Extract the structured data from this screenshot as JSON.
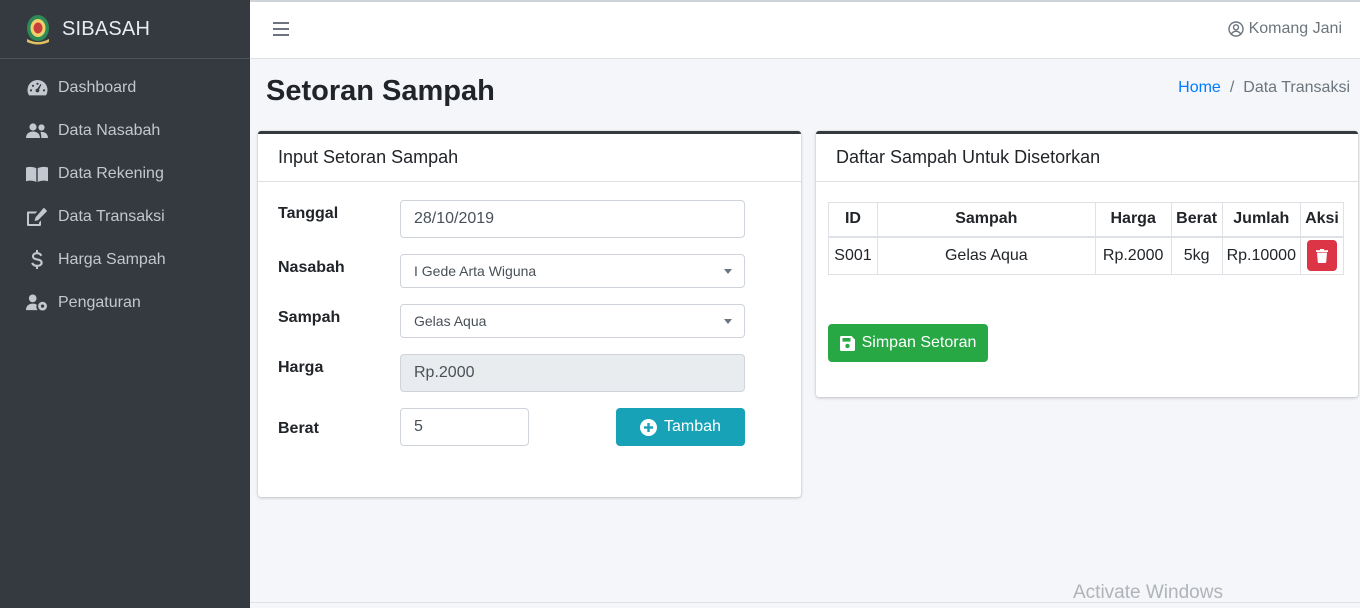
{
  "app": {
    "brand": "SIBASAH"
  },
  "sidebar": {
    "items": [
      {
        "label": "Dashboard",
        "icon": "tachometer-icon"
      },
      {
        "label": "Data Nasabah",
        "icon": "users-icon"
      },
      {
        "label": "Data Rekening",
        "icon": "book-icon"
      },
      {
        "label": "Data Transaksi",
        "icon": "edit-icon"
      },
      {
        "label": "Harga Sampah",
        "icon": "dollar-icon"
      },
      {
        "label": "Pengaturan",
        "icon": "user-cog-icon"
      }
    ]
  },
  "topbar": {
    "user_name": "Komang Jani"
  },
  "header": {
    "title": "Setoran Sampah",
    "breadcrumb": {
      "home": "Home",
      "separator": "/",
      "current": "Data Transaksi"
    }
  },
  "form_card": {
    "title": "Input Setoran Sampah",
    "fields": {
      "tanggal": {
        "label": "Tanggal",
        "value": "28/10/2019"
      },
      "nasabah": {
        "label": "Nasabah",
        "value": "I Gede Arta Wiguna"
      },
      "sampah": {
        "label": "Sampah",
        "value": "Gelas Aqua"
      },
      "harga": {
        "label": "Harga",
        "value": "Rp.2000"
      },
      "berat": {
        "label": "Berat",
        "value": "5"
      }
    },
    "add_button": "Tambah"
  },
  "list_card": {
    "title": "Daftar Sampah Untuk Disetorkan",
    "columns": [
      "ID",
      "Sampah",
      "Harga",
      "Berat",
      "Jumlah",
      "Aksi"
    ],
    "rows": [
      {
        "id": "S001",
        "sampah": "Gelas Aqua",
        "harga": "Rp.2000",
        "berat": "5kg",
        "jumlah": "Rp.10000"
      }
    ],
    "save_button": "Simpan Setoran"
  },
  "watermark": "Activate Windows",
  "colors": {
    "sidebar_bg": "#343a40",
    "info": "#17a2b8",
    "success": "#28a745",
    "danger": "#dc3545",
    "link": "#007bff"
  }
}
